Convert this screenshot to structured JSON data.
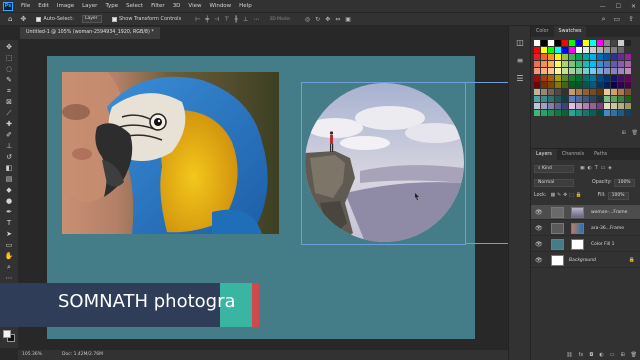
{
  "app": {
    "logo": "Ps"
  },
  "menu": [
    "File",
    "Edit",
    "Image",
    "Layer",
    "Type",
    "Select",
    "Filter",
    "3D",
    "View",
    "Window",
    "Help"
  ],
  "window_controls": [
    "—",
    "☐",
    "✕"
  ],
  "options": {
    "auto_select_label": "Auto-Select:",
    "auto_select_value": "Layer",
    "show_transform_label": "Show Transform Controls",
    "mode_3d_label": "3D Mode:"
  },
  "document": {
    "tab_title": "Untitled-1 @ 105% (woman-2594934_1920, RGB/8) *",
    "zoom": "105.36%",
    "doc_size": "Doc: 1.42M/2.76M"
  },
  "overlay": {
    "name_text": "SOMNATH photogra",
    "colors": {
      "dark": "#2f3d58",
      "green": "#39b5a1",
      "red": "#d0494f"
    }
  },
  "panels": {
    "top_tabs": [
      "Color",
      "Swatches"
    ],
    "active_top_tab": "Swatches",
    "layer_tabs": [
      "Layers",
      "Channels",
      "Paths"
    ],
    "kind_label": "Kind",
    "blend_mode": "Normal",
    "opacity_label": "Opacity:",
    "opacity_value": "100%",
    "lock_label": "Lock:",
    "fill_label": "Fill:",
    "fill_value": "100%",
    "layers": [
      {
        "name": "woman-...Frame",
        "selected": true
      },
      {
        "name": "ara-36...Frame",
        "selected": false
      },
      {
        "name": "Color Fill 1",
        "selected": false
      },
      {
        "name": "Background",
        "selected": false
      }
    ]
  },
  "colors": {
    "artboard": "#447d87",
    "selection": "#6f9fd8"
  }
}
